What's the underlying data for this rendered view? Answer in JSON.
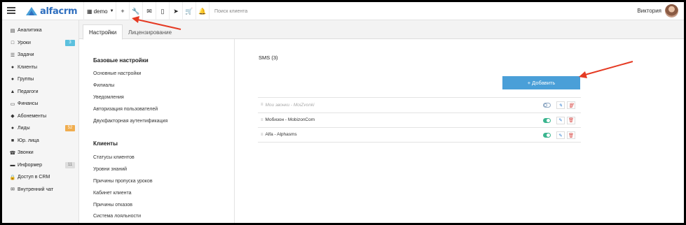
{
  "topbar": {
    "logo_text": "alfacrm",
    "branch_label": "demo",
    "search_placeholder": "Поиск клиента",
    "user_name": "Виктория",
    "tool_icons": [
      "plus-icon",
      "wrench-icon",
      "mail-icon",
      "mobile-icon",
      "telegram-icon",
      "cart-icon",
      "bell-icon"
    ]
  },
  "sidebar": {
    "items": [
      {
        "icon": "chart-icon",
        "label": "Аналитика"
      },
      {
        "icon": "calendar-icon",
        "label": "Уроки",
        "badge": "3"
      },
      {
        "icon": "tasks-icon",
        "label": "Задачи"
      },
      {
        "icon": "user-icon",
        "label": "Клиенты"
      },
      {
        "icon": "users-icon",
        "label": "Группы"
      },
      {
        "icon": "graduation-icon",
        "label": "Педагоги"
      },
      {
        "icon": "money-icon",
        "label": "Финансы"
      },
      {
        "icon": "tag-icon",
        "label": "Абонементы"
      },
      {
        "icon": "user-plus-icon",
        "label": "Лиды",
        "badge": "52"
      },
      {
        "icon": "briefcase-icon",
        "label": "Юр. лица"
      },
      {
        "icon": "phone-icon",
        "label": "Звонки"
      },
      {
        "icon": "inbox-icon",
        "label": "Информер",
        "badge": "11"
      },
      {
        "icon": "lock-icon",
        "label": "Доступ в CRM"
      },
      {
        "icon": "chat-icon",
        "label": "Внутренний чат"
      }
    ]
  },
  "tabs": [
    "Настройки",
    "Лицензирование"
  ],
  "settings": {
    "base_title": "Базовые настройки",
    "base_links": [
      "Основные настройки",
      "Филиалы",
      "Уведомления",
      "Авторизация пользователей",
      "Двухфакторная аутентификация"
    ],
    "clients_title": "Клиенты",
    "clients_links": [
      "Статусы клиентов",
      "Уровни знаний",
      "Причины пропуска уроков",
      "Кабинет клиента",
      "Причины отказов",
      "Система лояльности"
    ]
  },
  "sms": {
    "title": "SMS (3)",
    "add_label": "+ Добавить",
    "providers": [
      {
        "name": "Мои звонки - MoiZvonki",
        "enabled": false
      },
      {
        "name": "Мобизон - MobizonCom",
        "enabled": true
      },
      {
        "name": "Alfa - Alphasms",
        "enabled": true
      }
    ]
  },
  "colors": {
    "brand": "#2f6fbf",
    "add_button": "#4a9fd8",
    "toggle_on": "#3bb58f",
    "badge_lessons": "#5bc0de",
    "badge_leads": "#f0ad4e",
    "annotation_arrow": "#e53a23"
  }
}
